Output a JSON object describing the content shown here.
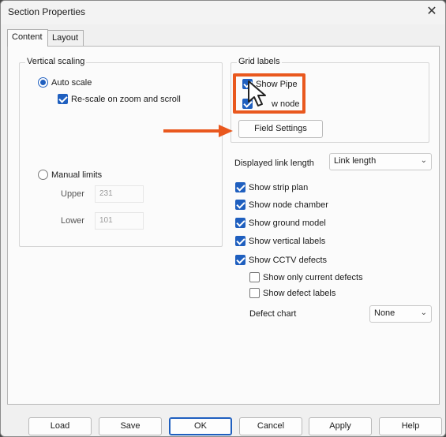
{
  "window": {
    "title": "Section Properties",
    "close_glyph": "✕"
  },
  "tabs": [
    {
      "label": "Content",
      "active": true
    },
    {
      "label": "Layout",
      "active": false
    }
  ],
  "vertical_scaling": {
    "title": "Vertical scaling",
    "auto_scale": {
      "label": "Auto scale",
      "selected": true
    },
    "rescale": {
      "label": "Re-scale on zoom and scroll",
      "checked": true
    },
    "manual_limits": {
      "label": "Manual limits",
      "selected": false
    },
    "upper": {
      "label": "Upper",
      "value": "231"
    },
    "lower": {
      "label": "Lower",
      "value": "101"
    }
  },
  "grid_labels": {
    "title": "Grid labels",
    "show_pipe": {
      "label": "Show Pipe",
      "checked": true
    },
    "show_node": {
      "label": "w node",
      "checked": true
    },
    "field_settings_label": "Field Settings"
  },
  "displayed_link_length": {
    "label": "Displayed link length",
    "value": "Link length"
  },
  "options": [
    {
      "label": "Show strip plan",
      "checked": true
    },
    {
      "label": "Show node chamber",
      "checked": true
    },
    {
      "label": "Show ground model",
      "checked": true
    },
    {
      "label": "Show vertical labels",
      "checked": true
    },
    {
      "label": "Show CCTV defects",
      "checked": true
    }
  ],
  "cctv_options": [
    {
      "label": "Show only current defects",
      "checked": false
    },
    {
      "label": "Show defect labels",
      "checked": false
    }
  ],
  "defect_chart": {
    "label": "Defect chart",
    "value": "None"
  },
  "buttons": {
    "load": "Load",
    "save": "Save",
    "ok": "OK",
    "cancel": "Cancel",
    "apply": "Apply",
    "help": "Help"
  },
  "colors": {
    "accent": "#1f5fbf",
    "annotation": "#e9581e"
  },
  "icons": {
    "close": "close-icon",
    "dropdown": "chevron-down-icon",
    "cursor": "mouse-pointer-icon",
    "arrow": "arrow-right-icon"
  }
}
